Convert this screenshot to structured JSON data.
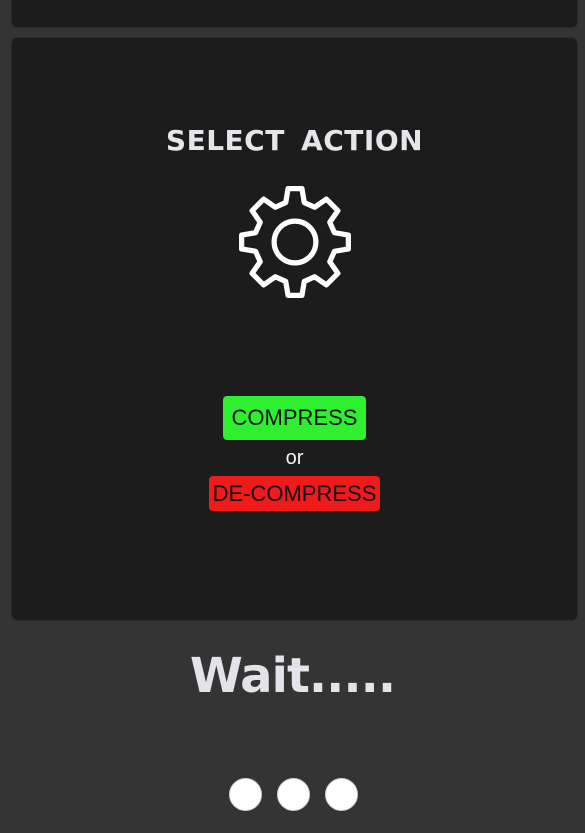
{
  "card": {
    "title": "SELECT ACTION",
    "icon": "gear-icon"
  },
  "actions": {
    "compress_label": "COMPRESS",
    "or_label": "or",
    "decompress_label": "DE-COMPRESS"
  },
  "status": {
    "wait_text": "Wait....."
  },
  "colors": {
    "page_background": "#343434",
    "card_background": "#1c1c1c",
    "compress_button": "#2ff02f",
    "decompress_button": "#f01a1a",
    "text_light": "#e6e6ea"
  }
}
